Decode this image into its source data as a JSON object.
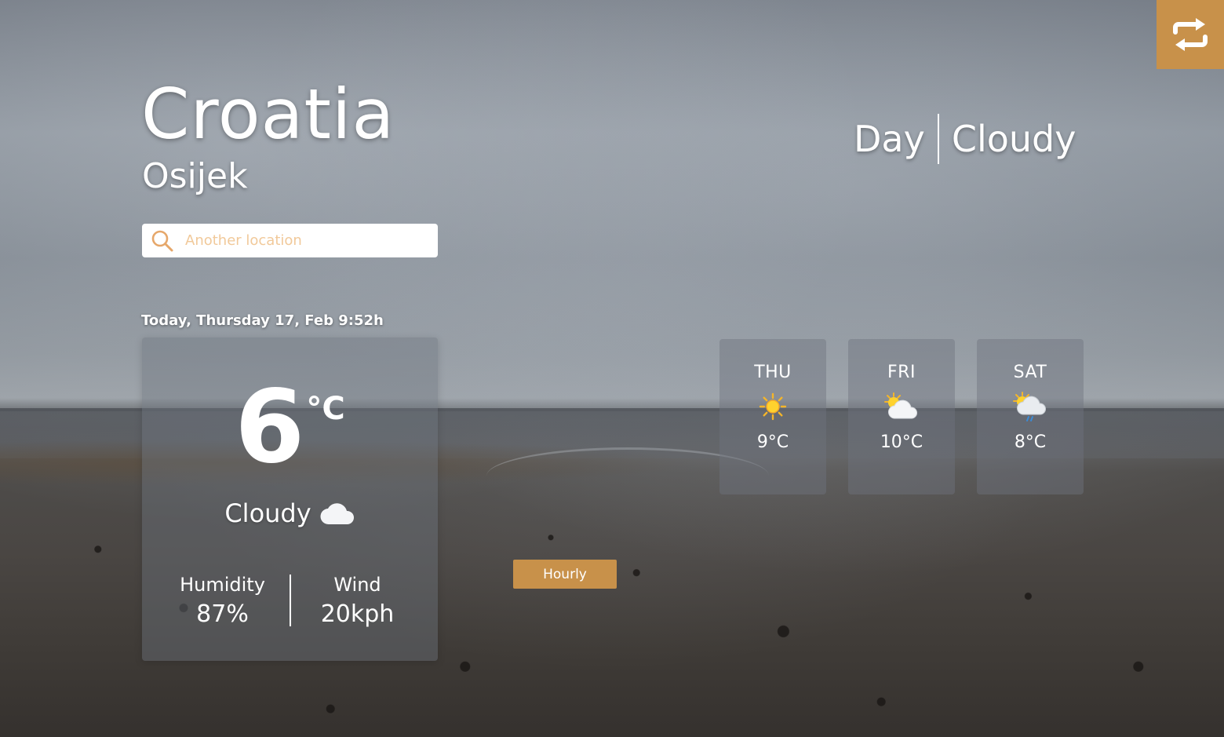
{
  "location": {
    "country": "Croatia",
    "city": "Osijek"
  },
  "header": {
    "period": "Day",
    "condition": "Cloudy"
  },
  "search": {
    "placeholder": "Another location",
    "value": ""
  },
  "today": {
    "date_text": "Today, Thursday 17, Feb 9:52h",
    "temperature": "6",
    "unit": "°C",
    "condition": "Cloudy",
    "condition_icon": "cloud-icon",
    "humidity_label": "Humidity",
    "humidity_value": "87%",
    "wind_label": "Wind",
    "wind_value": "20kph"
  },
  "hourly_button": {
    "label": "Hourly"
  },
  "forecast": [
    {
      "day": "THU",
      "icon": "sun-icon",
      "temp": "9°C"
    },
    {
      "day": "FRI",
      "icon": "sun-cloud-icon",
      "temp": "10°C"
    },
    {
      "day": "SAT",
      "icon": "sun-cloud-rain-icon",
      "temp": "8°C"
    }
  ],
  "colors": {
    "accent": "#c8914a",
    "placeholder": "#f1c99a",
    "card": "rgba(110,116,126,0.42)",
    "text": "#ffffff"
  },
  "switch_button": {
    "icon": "swap-arrows-icon"
  }
}
